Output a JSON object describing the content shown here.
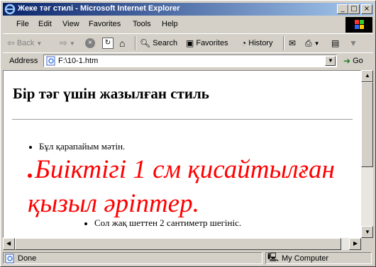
{
  "window": {
    "title": "Жеке тәг стилі - Microsoft Internet Explorer",
    "min_glyph": "_",
    "max_glyph": "□",
    "close_glyph": "×"
  },
  "menu": [
    "File",
    "Edit",
    "View",
    "Favorites",
    "Tools",
    "Help"
  ],
  "toolbar": {
    "back": "Back",
    "search": "Search",
    "favorites": "Favorites",
    "history": "History"
  },
  "address": {
    "label": "Address",
    "value": "F:\\10-1.htm",
    "go": "Go"
  },
  "page": {
    "heading": "Бір тәг үшін жазылған стиль",
    "items": [
      "Бұл қарапайым мәтін.",
      "Биіктігі 1 см қисайтылған қызыл әріптер.",
      "Сол жақ шеттен 2 сантиметр шегініс."
    ],
    "red_color": "#ff0000"
  },
  "status": {
    "text": "Done",
    "zone": "My Computer"
  }
}
